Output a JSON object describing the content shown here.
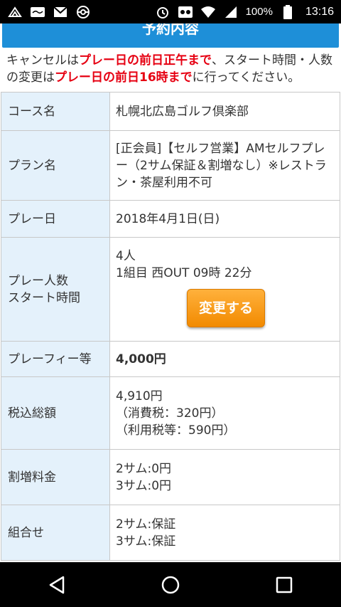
{
  "status_bar": {
    "battery_percent": "100%",
    "time": "13:16",
    "icons_left": [
      "sms-icon",
      "app-notification-icon",
      "gmail-icon",
      "pokeball-icon"
    ],
    "icons_right": [
      "alarm-icon",
      "voicemail-icon",
      "wifi-icon",
      "signal-icon",
      "battery-icon"
    ]
  },
  "page": {
    "section_title": "予約内容",
    "notice": {
      "p1": "キャンセルは",
      "p2": "プレー日の前日正午まで",
      "p3": "、スタート時間・人数の変更は",
      "p4": "プレー日の前日16時まで",
      "p5": "に行ってください。"
    },
    "rows": {
      "course": {
        "label": "コース名",
        "value": "札幌北広島ゴルフ倶楽部"
      },
      "plan": {
        "label": "プラン名",
        "value": "[正会員]【セルフ営業】AMセルフプレー（2サム保証＆割増なし）※レストラン・茶屋利用不可"
      },
      "play_date": {
        "label": "プレー日",
        "value": "2018年4月1日(日)"
      },
      "players": {
        "label_line1": "プレー人数",
        "label_line2": "スタート時間",
        "count": "4人",
        "start": "1組目 西OUT  09時 22分",
        "change_button": "変更する"
      },
      "fee": {
        "label": "プレーフィー等",
        "value": "4,000円"
      },
      "total": {
        "label": "税込総額",
        "amount": "4,910円",
        "consumption_tax": "（消費税：320円）",
        "usage_tax": "（利用税等：590円）"
      },
      "surcharge": {
        "label": "割増料金",
        "line1": "2サム:0円",
        "line2": "3サム:0円"
      },
      "grouping": {
        "label": "組合せ",
        "line1": "2サム:保証",
        "line2": "3サム:保証"
      }
    }
  },
  "nav_bar": {
    "buttons": [
      "back-icon",
      "home-icon",
      "recents-icon"
    ]
  }
}
